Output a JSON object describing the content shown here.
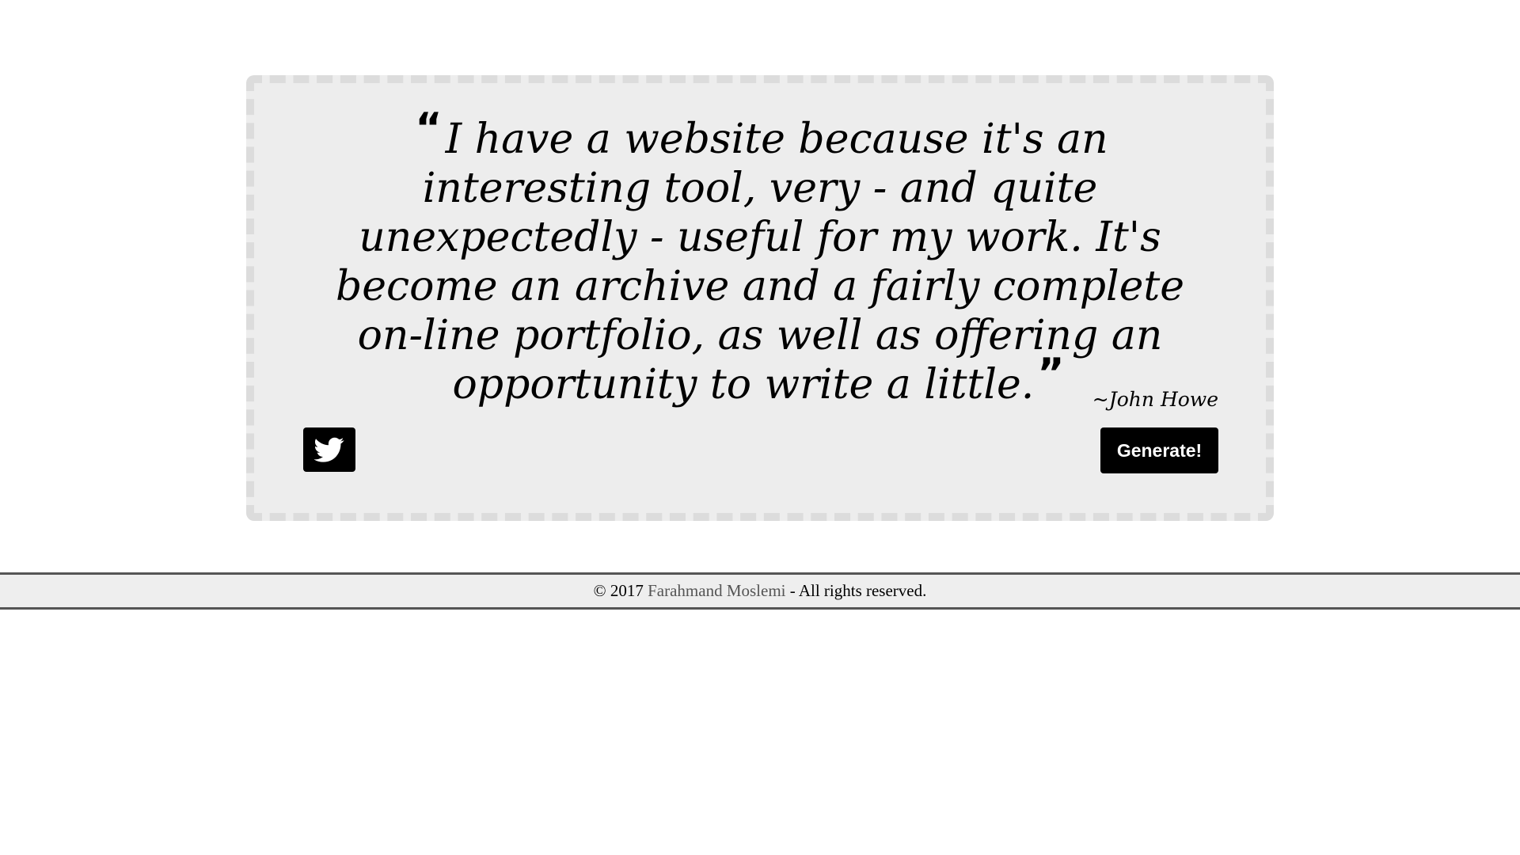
{
  "quote": {
    "open_mark": "“",
    "text": "I have a website because it's an interesting tool, very - and quite unexpectedly - useful for my work. It's become an archive and a fairly complete on-line portfolio, as well as offering an opportunity to write a little.",
    "close_mark": "”",
    "author": "~John Howe"
  },
  "actions": {
    "tweet_icon": "twitter-bird-icon",
    "generate_label": "Generate!"
  },
  "footer": {
    "prefix": "© 2017 ",
    "author_link": "Farahmand Moslemi",
    "suffix": " - All rights reserved."
  },
  "colors": {
    "card_background": "#ededed",
    "card_border": "#dcdcdc",
    "button_background": "#000000",
    "button_text": "#ffffff",
    "footer_background": "#eeeeee",
    "footer_link": "#555555"
  }
}
